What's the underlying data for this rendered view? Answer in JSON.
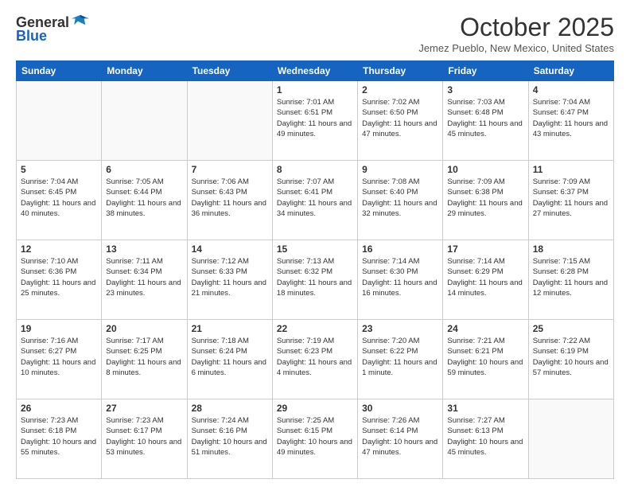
{
  "header": {
    "logo_general": "General",
    "logo_blue": "Blue",
    "month": "October 2025",
    "location": "Jemez Pueblo, New Mexico, United States"
  },
  "days_of_week": [
    "Sunday",
    "Monday",
    "Tuesday",
    "Wednesday",
    "Thursday",
    "Friday",
    "Saturday"
  ],
  "weeks": [
    [
      {
        "day": "",
        "info": ""
      },
      {
        "day": "",
        "info": ""
      },
      {
        "day": "",
        "info": ""
      },
      {
        "day": "1",
        "info": "Sunrise: 7:01 AM\nSunset: 6:51 PM\nDaylight: 11 hours and 49 minutes."
      },
      {
        "day": "2",
        "info": "Sunrise: 7:02 AM\nSunset: 6:50 PM\nDaylight: 11 hours and 47 minutes."
      },
      {
        "day": "3",
        "info": "Sunrise: 7:03 AM\nSunset: 6:48 PM\nDaylight: 11 hours and 45 minutes."
      },
      {
        "day": "4",
        "info": "Sunrise: 7:04 AM\nSunset: 6:47 PM\nDaylight: 11 hours and 43 minutes."
      }
    ],
    [
      {
        "day": "5",
        "info": "Sunrise: 7:04 AM\nSunset: 6:45 PM\nDaylight: 11 hours and 40 minutes."
      },
      {
        "day": "6",
        "info": "Sunrise: 7:05 AM\nSunset: 6:44 PM\nDaylight: 11 hours and 38 minutes."
      },
      {
        "day": "7",
        "info": "Sunrise: 7:06 AM\nSunset: 6:43 PM\nDaylight: 11 hours and 36 minutes."
      },
      {
        "day": "8",
        "info": "Sunrise: 7:07 AM\nSunset: 6:41 PM\nDaylight: 11 hours and 34 minutes."
      },
      {
        "day": "9",
        "info": "Sunrise: 7:08 AM\nSunset: 6:40 PM\nDaylight: 11 hours and 32 minutes."
      },
      {
        "day": "10",
        "info": "Sunrise: 7:09 AM\nSunset: 6:38 PM\nDaylight: 11 hours and 29 minutes."
      },
      {
        "day": "11",
        "info": "Sunrise: 7:09 AM\nSunset: 6:37 PM\nDaylight: 11 hours and 27 minutes."
      }
    ],
    [
      {
        "day": "12",
        "info": "Sunrise: 7:10 AM\nSunset: 6:36 PM\nDaylight: 11 hours and 25 minutes."
      },
      {
        "day": "13",
        "info": "Sunrise: 7:11 AM\nSunset: 6:34 PM\nDaylight: 11 hours and 23 minutes."
      },
      {
        "day": "14",
        "info": "Sunrise: 7:12 AM\nSunset: 6:33 PM\nDaylight: 11 hours and 21 minutes."
      },
      {
        "day": "15",
        "info": "Sunrise: 7:13 AM\nSunset: 6:32 PM\nDaylight: 11 hours and 18 minutes."
      },
      {
        "day": "16",
        "info": "Sunrise: 7:14 AM\nSunset: 6:30 PM\nDaylight: 11 hours and 16 minutes."
      },
      {
        "day": "17",
        "info": "Sunrise: 7:14 AM\nSunset: 6:29 PM\nDaylight: 11 hours and 14 minutes."
      },
      {
        "day": "18",
        "info": "Sunrise: 7:15 AM\nSunset: 6:28 PM\nDaylight: 11 hours and 12 minutes."
      }
    ],
    [
      {
        "day": "19",
        "info": "Sunrise: 7:16 AM\nSunset: 6:27 PM\nDaylight: 11 hours and 10 minutes."
      },
      {
        "day": "20",
        "info": "Sunrise: 7:17 AM\nSunset: 6:25 PM\nDaylight: 11 hours and 8 minutes."
      },
      {
        "day": "21",
        "info": "Sunrise: 7:18 AM\nSunset: 6:24 PM\nDaylight: 11 hours and 6 minutes."
      },
      {
        "day": "22",
        "info": "Sunrise: 7:19 AM\nSunset: 6:23 PM\nDaylight: 11 hours and 4 minutes."
      },
      {
        "day": "23",
        "info": "Sunrise: 7:20 AM\nSunset: 6:22 PM\nDaylight: 11 hours and 1 minute."
      },
      {
        "day": "24",
        "info": "Sunrise: 7:21 AM\nSunset: 6:21 PM\nDaylight: 10 hours and 59 minutes."
      },
      {
        "day": "25",
        "info": "Sunrise: 7:22 AM\nSunset: 6:19 PM\nDaylight: 10 hours and 57 minutes."
      }
    ],
    [
      {
        "day": "26",
        "info": "Sunrise: 7:23 AM\nSunset: 6:18 PM\nDaylight: 10 hours and 55 minutes."
      },
      {
        "day": "27",
        "info": "Sunrise: 7:23 AM\nSunset: 6:17 PM\nDaylight: 10 hours and 53 minutes."
      },
      {
        "day": "28",
        "info": "Sunrise: 7:24 AM\nSunset: 6:16 PM\nDaylight: 10 hours and 51 minutes."
      },
      {
        "day": "29",
        "info": "Sunrise: 7:25 AM\nSunset: 6:15 PM\nDaylight: 10 hours and 49 minutes."
      },
      {
        "day": "30",
        "info": "Sunrise: 7:26 AM\nSunset: 6:14 PM\nDaylight: 10 hours and 47 minutes."
      },
      {
        "day": "31",
        "info": "Sunrise: 7:27 AM\nSunset: 6:13 PM\nDaylight: 10 hours and 45 minutes."
      },
      {
        "day": "",
        "info": ""
      }
    ]
  ]
}
